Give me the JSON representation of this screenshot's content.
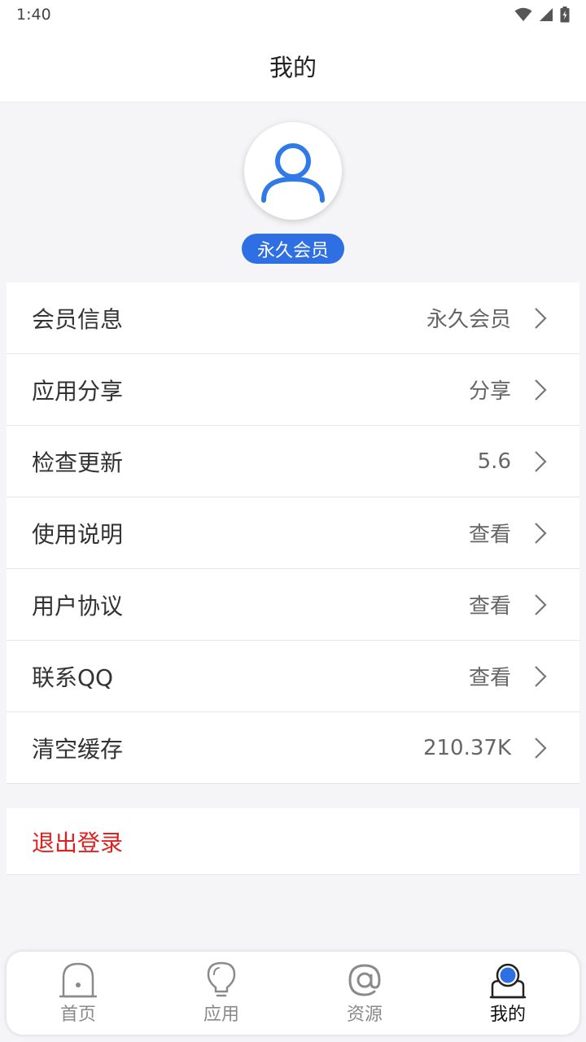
{
  "status_bar": {
    "time": "1:40",
    "icons": [
      "wifi-icon",
      "signal-icon",
      "battery-charging-icon"
    ]
  },
  "header": {
    "title": "我的"
  },
  "profile": {
    "avatar_icon": "user-icon",
    "badge": "永久会员",
    "badge_color": "#2f6fe4"
  },
  "menu": {
    "items": [
      {
        "label": "会员信息",
        "value": "永久会员"
      },
      {
        "label": "应用分享",
        "value": "分享"
      },
      {
        "label": "检查更新",
        "value": "5.6"
      },
      {
        "label": "使用说明",
        "value": "查看"
      },
      {
        "label": "用户协议",
        "value": "查看"
      },
      {
        "label": "联系QQ",
        "value": "查看"
      },
      {
        "label": "清空缓存",
        "value": "210.37K"
      }
    ],
    "chevron_icon": "chevron-right-icon"
  },
  "logout": {
    "label": "退出登录",
    "color": "#e0201f"
  },
  "bottom_nav": {
    "items": [
      {
        "label": "首页",
        "icon": "home-icon"
      },
      {
        "label": "应用",
        "icon": "bulb-icon"
      },
      {
        "label": "资源",
        "icon": "at-icon"
      },
      {
        "label": "我的",
        "icon": "profile-icon",
        "active": true
      }
    ],
    "active_color": "#2f6fe4"
  }
}
